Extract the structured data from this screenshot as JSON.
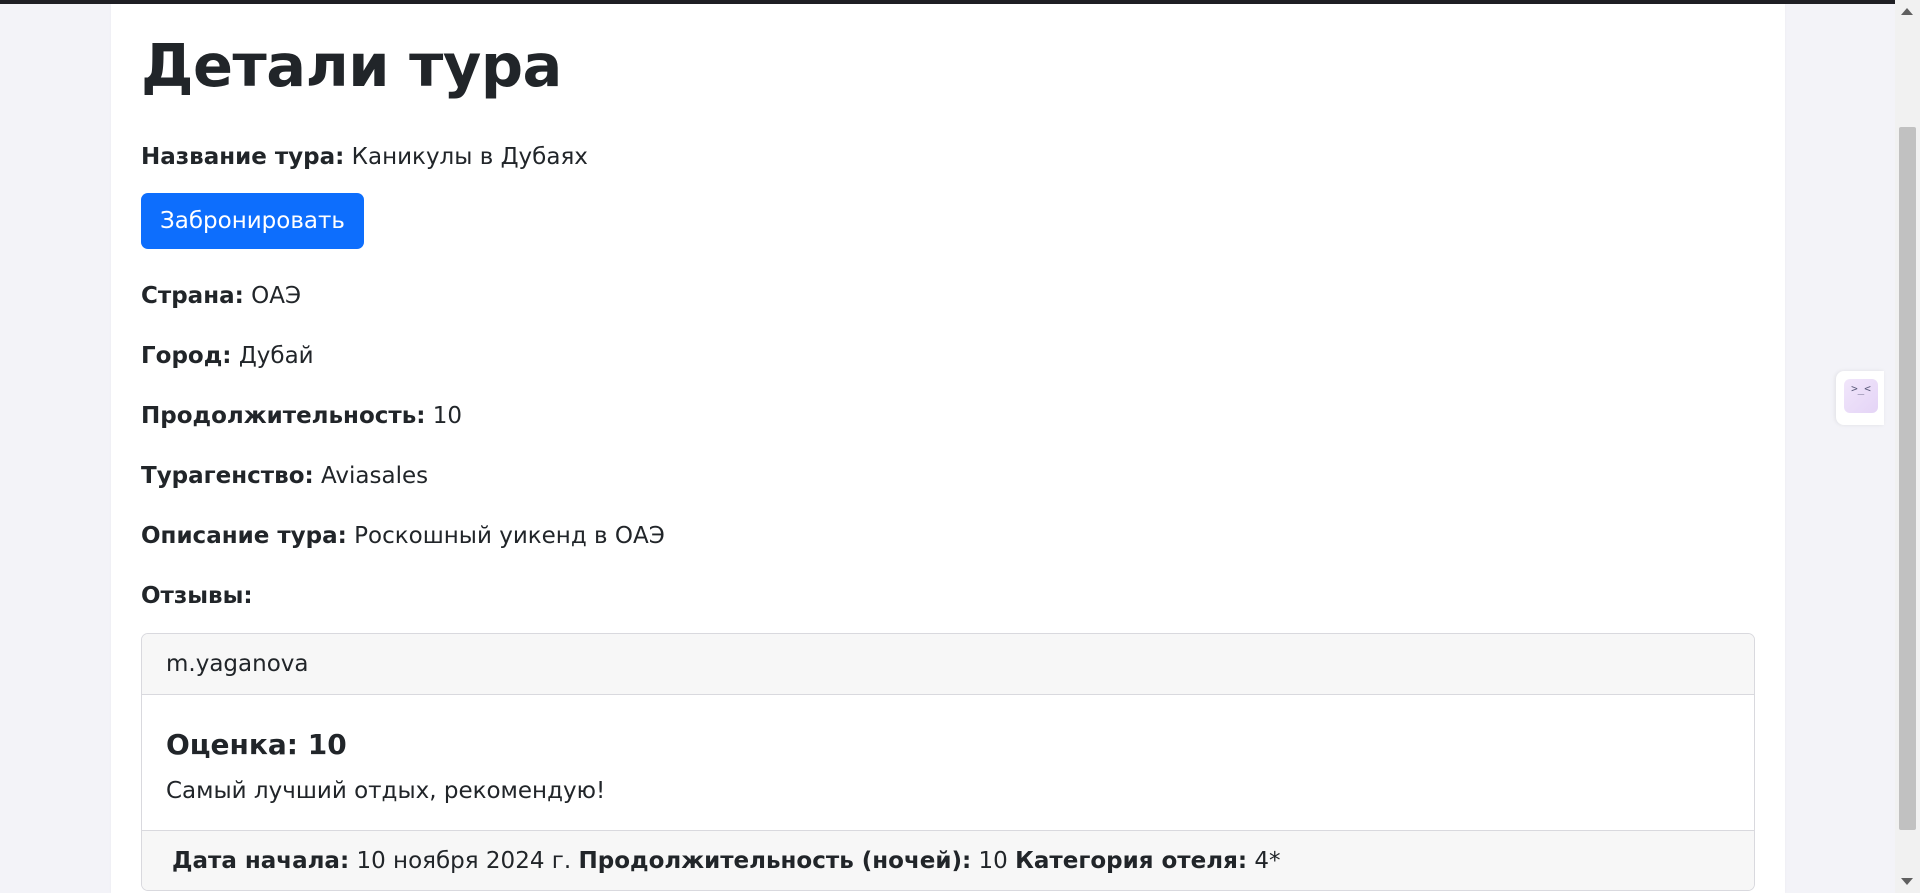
{
  "page": {
    "title": "Детали тура"
  },
  "tour": {
    "name_label": "Название тура:",
    "name_value": "Каникулы в Дубаях",
    "book_button": "Забронировать",
    "country_label": "Страна:",
    "country_value": "ОАЭ",
    "city_label": "Город:",
    "city_value": "Дубай",
    "duration_label": "Продолжительность:",
    "duration_value": "10",
    "agency_label": "Турагенство:",
    "agency_value": "Aviasales",
    "description_label": "Описание тура:",
    "description_value": "Роскошный уикенд в ОАЭ",
    "reviews_label": "Отзывы:"
  },
  "reviews": [
    {
      "author": "m.yaganova",
      "rating": "Оценка: 10",
      "text": "Самый лучший отдых, рекомендую!",
      "start_label": "Дата начала:",
      "start_value": "10 ноября 2024 г.",
      "nights_label": "Продолжительность (ночей):",
      "nights_value": "10",
      "hotel_label": "Категория отеля:",
      "hotel_value": "4*"
    }
  ],
  "side_widget": {
    "icon": "face-icon",
    "glyph": ">_<"
  },
  "colors": {
    "primary_button": "#0d6efd",
    "page_background": "#f3f3f8",
    "card_header": "#f7f7f7"
  }
}
